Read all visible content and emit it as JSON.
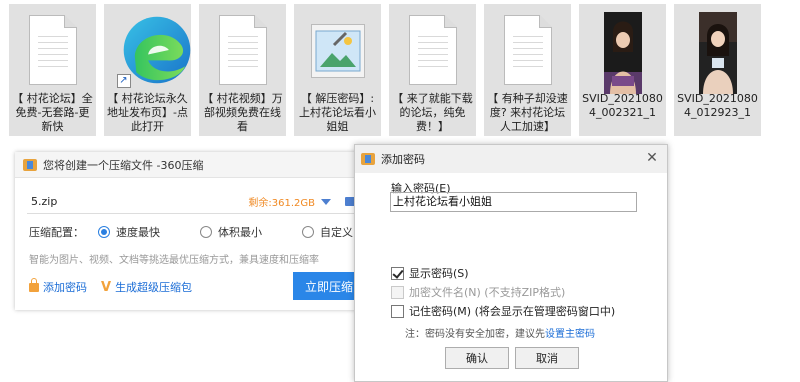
{
  "files": [
    {
      "kind": "doc",
      "label": "【 村花论坛】全免费-无套路-更新快"
    },
    {
      "kind": "edge",
      "label": "【 村花论坛永久地址发布页】-点此打开",
      "icon": "edge-browser-icon"
    },
    {
      "kind": "doc",
      "label": "【 村花视频】万部视频免费在线看"
    },
    {
      "kind": "image",
      "label": "【 解压密码】: 上村花论坛看小姐姐",
      "icon": "image-file-icon"
    },
    {
      "kind": "doc",
      "label": "【 来了就能下载的论坛，纯免费！】"
    },
    {
      "kind": "doc",
      "label": "【 有种子却没速度? 来村花论坛人工加速】"
    },
    {
      "kind": "video",
      "label": "SVID_20210804_002321_1"
    },
    {
      "kind": "video",
      "label": "SVID_20210804_012923_1"
    }
  ],
  "compress": {
    "title": "您将创建一个压缩文件 -360压缩",
    "filename": "5.zip",
    "free_space": "剩余:361.2GB",
    "config_label": "压缩配置：",
    "options": [
      "速度最快",
      "体积最小",
      "自定义"
    ],
    "selected_option": "速度最快",
    "hint": "智能为图片、视频、文档等挑选最优压缩方式，兼具速度和压缩率",
    "add_password": "添加密码",
    "super_package": "生成超级压缩包",
    "compress_now": "立即压缩",
    "colors": {
      "accent": "#2a86e8",
      "free": "#f08a24"
    }
  },
  "password_dialog": {
    "title": "添加密码",
    "input_label": "输入密码(E)",
    "password_value": "上村花论坛看小姐姐",
    "show_password": {
      "label": "显示密码(S)",
      "checked": true
    },
    "encrypt_names": {
      "label": "加密文件名(N) (不支持ZIP格式)",
      "checked": false,
      "disabled": true
    },
    "remember": {
      "label": "记住密码(M) (将会显示在管理密码窗口中)",
      "checked": false
    },
    "note_prefix": "注：密码没有安全加密，建议先",
    "note_link": "设置主密码",
    "ok": "确认",
    "cancel": "取消"
  }
}
